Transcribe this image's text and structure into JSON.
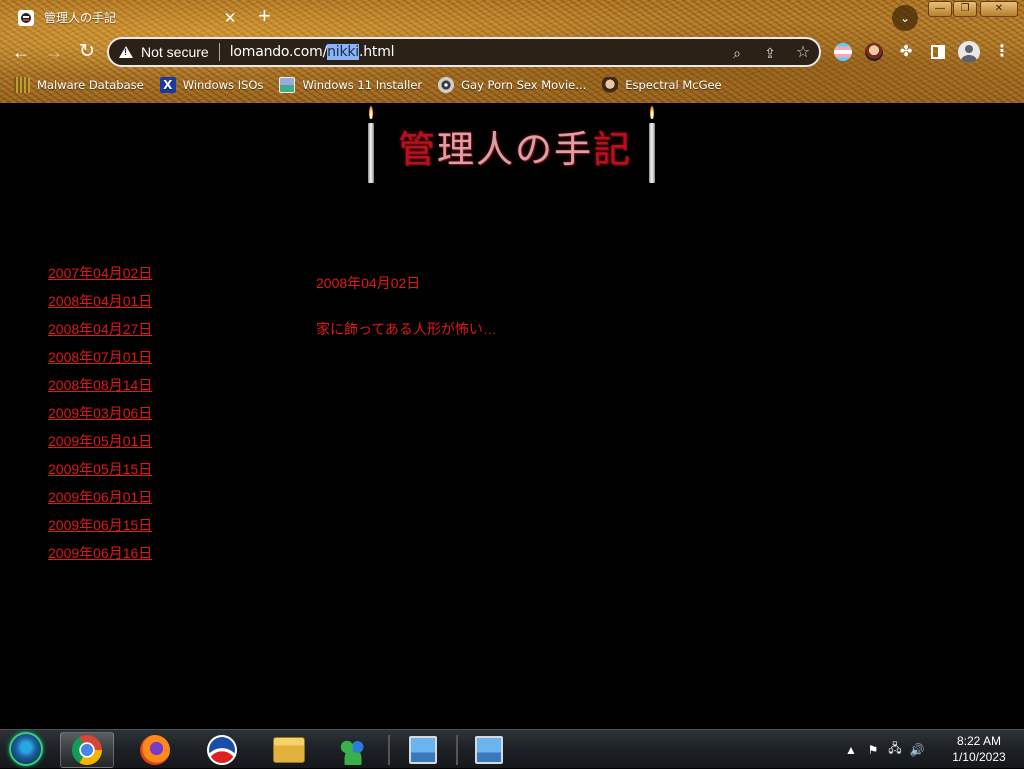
{
  "browser": {
    "tab": {
      "title": "管理人の手記",
      "close": "✕"
    },
    "new_tab": "+",
    "window": {
      "minimize": "—",
      "restore": "❐",
      "close": "✕"
    },
    "tab_search": "⌄",
    "toolbar": {
      "back": "←",
      "forward": "→",
      "reload": "↻",
      "security_label": "Not secure",
      "url": {
        "prefix": "lomando.com/",
        "selected": "nikki",
        "suffix": ".html"
      },
      "zoom_icon": "⌕",
      "share_icon": "⇪",
      "star_icon": "☆",
      "puzzle_icon": "✤",
      "menu_icon": "⋮"
    },
    "bookmarks": [
      {
        "label": "Malware Database",
        "icon": "malware-icon"
      },
      {
        "label": "Windows ISOs",
        "icon": "x-icon",
        "glyph": "X"
      },
      {
        "label": "Windows 11 Installer",
        "icon": "image-icon"
      },
      {
        "label": "Gay Porn Sex Movie...",
        "icon": "disc-icon"
      },
      {
        "label": "Espectral McGee",
        "icon": "face-icon"
      }
    ]
  },
  "page": {
    "title_red": "管",
    "title_rest": "理人の手",
    "title_end": "記",
    "archive": [
      "2007年04月02日",
      "2008年04月01日",
      "2008年04月27日",
      "2008年07月01日",
      "2008年08月14日",
      "2009年03月06日",
      "2009年05月01日",
      "2009年05月15日",
      "2009年06月01日",
      "2009年06月15日",
      "2009年06月16日"
    ],
    "entry": {
      "date": "2008年04月02日",
      "body": "家に飾ってある人形が怖い…"
    },
    "colors": {
      "link_red": "#e01818",
      "background": "#000000"
    }
  },
  "taskbar": {
    "apps": [
      "start",
      "chrome",
      "firefox",
      "obama",
      "explorer",
      "messenger",
      "rdp",
      "rdp"
    ],
    "tray": {
      "show_hidden": "▲",
      "flag": "⚑",
      "network": "🖧",
      "volume": "🔊"
    },
    "clock": {
      "time": "8:22 AM",
      "date": "1/10/2023"
    }
  }
}
